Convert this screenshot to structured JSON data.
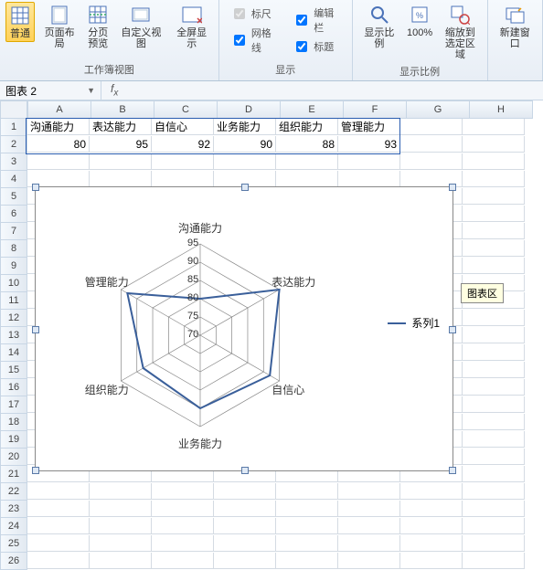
{
  "ribbon": {
    "group1": {
      "title": "工作簿视图",
      "btns": [
        {
          "label": "普通"
        },
        {
          "label": "页面布局"
        },
        {
          "label": "分页\n预览"
        },
        {
          "label": "自定义视图"
        },
        {
          "label": "全屏显示"
        }
      ]
    },
    "group2": {
      "title": "显示",
      "chks": [
        {
          "label": "标尺",
          "checked": true,
          "disabled": true
        },
        {
          "label": "编辑栏",
          "checked": true
        },
        {
          "label": "网格线",
          "checked": true
        },
        {
          "label": "标题",
          "checked": true
        }
      ]
    },
    "group3": {
      "title": "显示比例",
      "btns": [
        {
          "label": "显示比例"
        },
        {
          "label": "100%"
        },
        {
          "label": "缩放到\n选定区域"
        }
      ]
    },
    "group4": {
      "btns": [
        {
          "label": "新建窗口"
        }
      ]
    }
  },
  "namebox": "图表 2",
  "columns": [
    "A",
    "B",
    "C",
    "D",
    "E",
    "F",
    "G",
    "H"
  ],
  "rows": 26,
  "data": {
    "headers": [
      "沟通能力",
      "表达能力",
      "自信心",
      "业务能力",
      "组织能力",
      "管理能力"
    ],
    "values": [
      80,
      95,
      92,
      90,
      88,
      93
    ]
  },
  "chart_data": {
    "type": "radar",
    "categories": [
      "沟通能力",
      "表达能力",
      "自信心",
      "业务能力",
      "组织能力",
      "管理能力"
    ],
    "series": [
      {
        "name": "系列1",
        "values": [
          80,
          95,
          92,
          90,
          88,
          93
        ]
      }
    ],
    "ticks": [
      70,
      75,
      80,
      85,
      90,
      95
    ],
    "rlim": [
      70,
      95
    ]
  },
  "tooltip": "图表区",
  "legend": "系列1"
}
